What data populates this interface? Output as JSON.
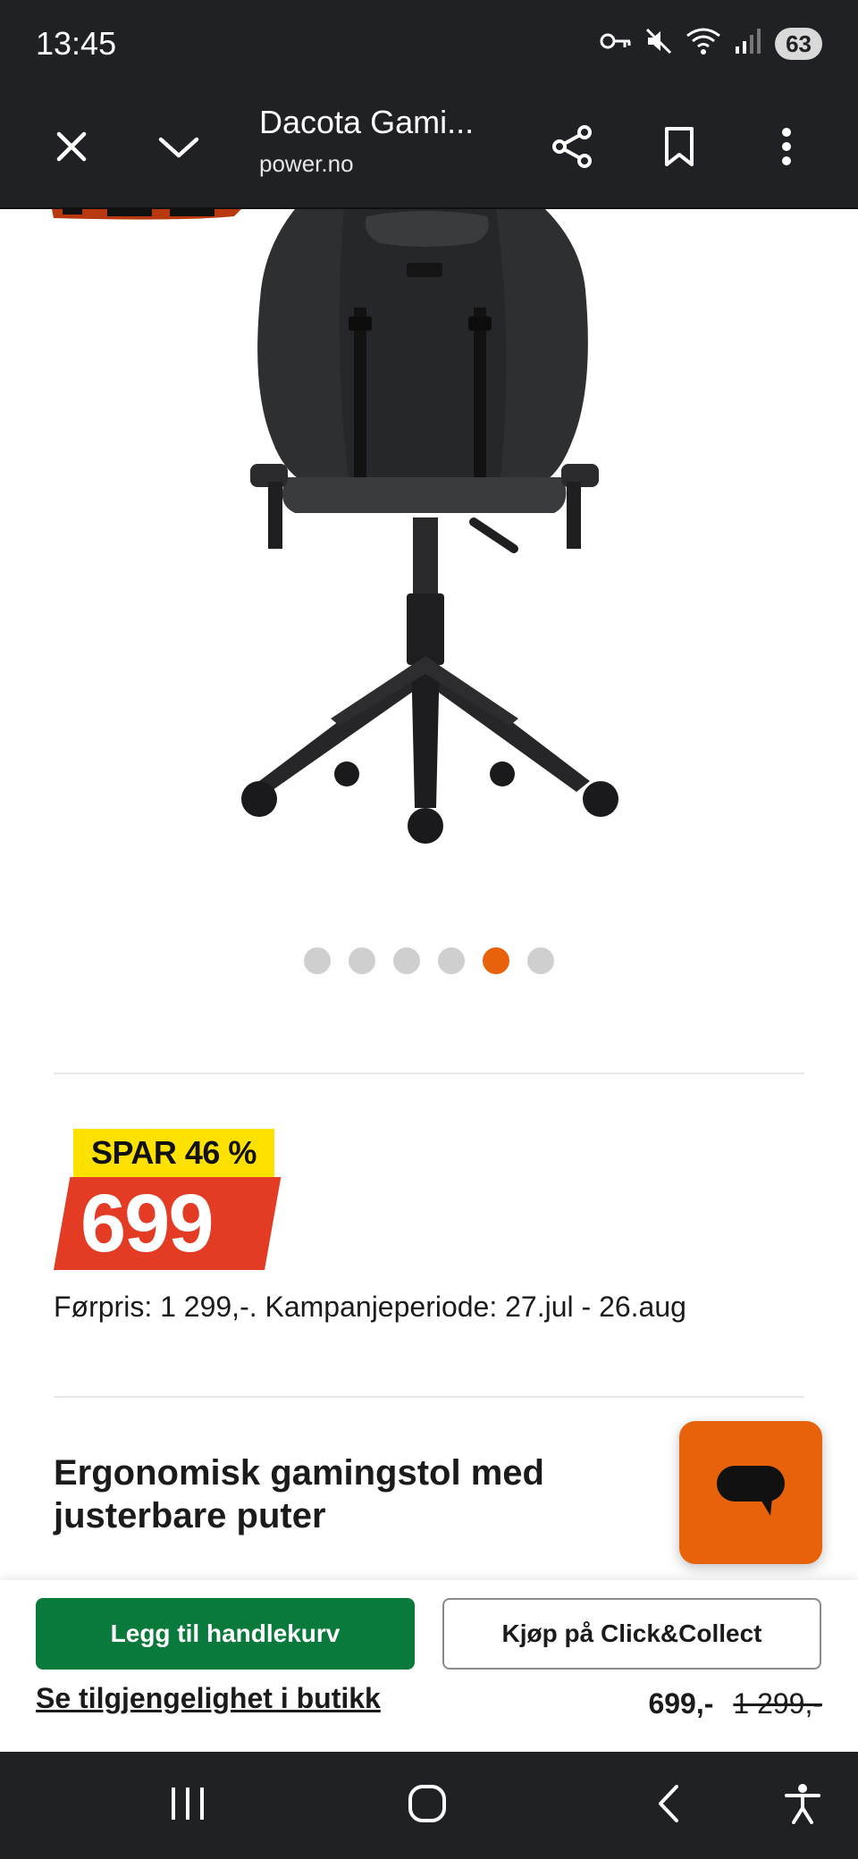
{
  "status_bar": {
    "time": "13:45",
    "battery": "63",
    "icons": [
      "key-icon",
      "mute-icon",
      "wifi-icon",
      "signal-icon"
    ]
  },
  "toolbar": {
    "title": "Dacota Gami...",
    "url": "power.no",
    "icons": [
      "close-icon",
      "chevron-down-icon",
      "share-icon",
      "bookmark-icon",
      "more-icon"
    ]
  },
  "carousel": {
    "count": 6,
    "active_index": 4
  },
  "price": {
    "save_label": "SPAR 46 %",
    "current": "699",
    "previous_text": "Førpris: 1 299,-. Kampanjeperiode: 27.jul - 26.aug"
  },
  "product": {
    "heading": "Ergonomisk gamingstol med justerbare puter"
  },
  "buy_bar": {
    "add_to_cart": "Legg til handlekurv",
    "click_collect": "Kjøp på Click&Collect",
    "availability_link": "Se tilgjengelighet i butikk",
    "price_now": "699,-",
    "price_old": "1 299,-"
  },
  "colors": {
    "accent_orange": "#e8620c",
    "save_yellow": "#ffe100",
    "price_red": "#e43b24",
    "cart_green": "#0a7a3c",
    "chrome_dark": "#202124"
  }
}
